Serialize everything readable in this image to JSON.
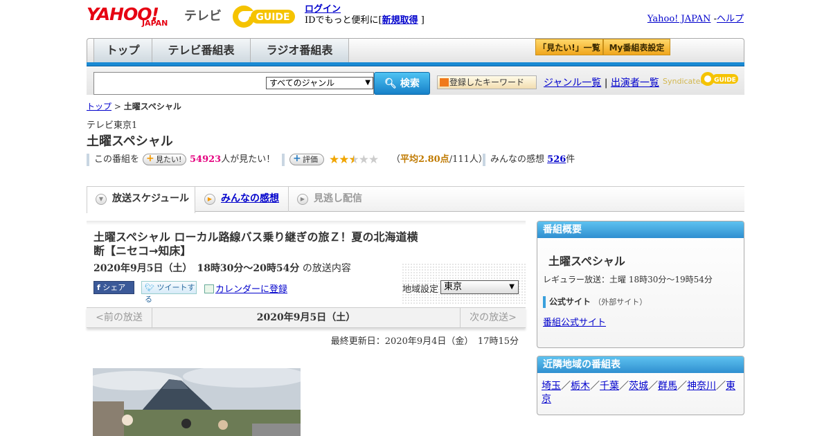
{
  "header": {
    "logo_text": "YAHOO!",
    "logo_sub": "JAPAN",
    "logo_tv": "テレビ",
    "gguide_logo": "G GUIDE",
    "login_link": "ログイン",
    "login_text": "IDでもっと便利に[",
    "signup_link": "新規取得",
    "login_close": "]",
    "yahoo_link": "Yahoo! JAPAN",
    "separator": "-",
    "help_link": "ヘルプ"
  },
  "nav": {
    "tabs": [
      {
        "label": "トップ"
      },
      {
        "label": "テレビ番組表"
      },
      {
        "label": "ラジオ番組表"
      }
    ],
    "mitai_list": "「見たい!」一覧",
    "my_settings": "My番組表設定"
  },
  "search": {
    "genre_select": "すべてのジャンル",
    "search_button": "検索",
    "keyword_button": "登録したキーワード",
    "genre_list_link": "ジャンル一覧",
    "divider": "|",
    "cast_list_link": "出演者一覧",
    "syndicated": "Syndicated"
  },
  "breadcrumb": {
    "top": "トップ",
    "sep": ">",
    "current": "土曜スペシャル"
  },
  "program": {
    "channel": "テレビ東京1",
    "title": "土曜スペシャル",
    "this_program": "この番組を",
    "mitai_pill": "見たい!",
    "mitai_count": "54923",
    "mitai_suffix": "人が見たい！",
    "rate_pill": "評価",
    "rating_stars": 2.8,
    "avg_open": "（",
    "avg_label": "平均2.80点",
    "avg_people": "/111人）",
    "impressions_label": "みんなの感想",
    "impressions_count": "526",
    "impressions_suffix": "件"
  },
  "subtabs": [
    {
      "label": "放送スケジュール",
      "state": "active"
    },
    {
      "label": "みんなの感想",
      "state": "link"
    },
    {
      "label": "見逃し配信",
      "state": "disabled"
    }
  ],
  "episode": {
    "title": "土曜スペシャル ローカル路線バス乗り継ぎの旅Ｚ！夏の北海道横断【ニセコ→知床】",
    "datetime": "2020年9月5日（土）　18時30分～20時54分",
    "datetime_suffix": "の放送内容",
    "fb_share": "シェア",
    "tweet": "ツイートする",
    "calendar": "カレンダーに登録",
    "region_label": "地域設定",
    "region_value": "東京"
  },
  "pager": {
    "prev": "<前の放送",
    "current": "2020年9月5日（土）",
    "next": "次の放送>"
  },
  "updated": "最終更新日：2020年9月4日（金）　17時15分",
  "overview": {
    "header": "番組概要",
    "title": "土曜スペシャル",
    "regular": "レギュラー放送：土曜 18時30分～19時54分",
    "official_label": "公式サイト",
    "official_note": "（外部サイト）",
    "official_link": "番組公式サイト"
  },
  "neighbors": {
    "header": "近隣地域の番組表",
    "regions": [
      "埼玉",
      "栃木",
      "千葉",
      "茨城",
      "群馬",
      "神奈川",
      "東京"
    ],
    "separator": "／"
  },
  "colors": {
    "accent_blue": "#1a8ad4",
    "rating_star": "#f0a500",
    "count_pink": "#e4007f",
    "avg_orange": "#c07a00"
  }
}
